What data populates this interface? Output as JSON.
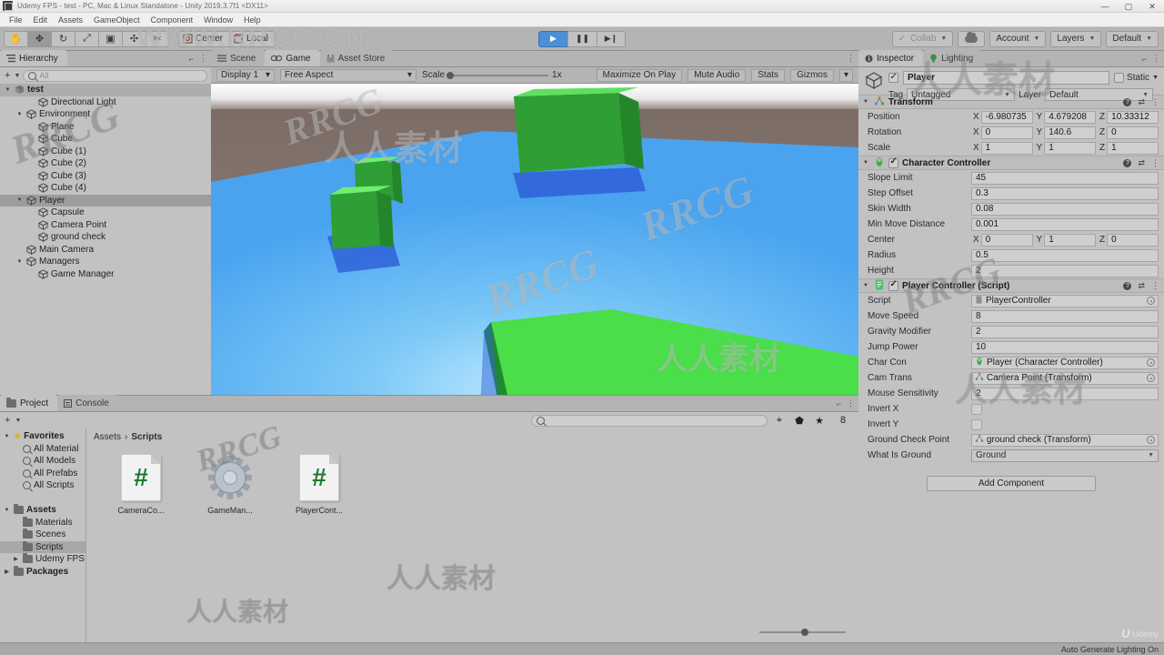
{
  "window": {
    "title": "Udemy FPS - test - PC, Mac & Linux Standalone - Unity 2019.3.7f1 <DX11>",
    "minimize": "—",
    "maximize": "▢",
    "close": "✕"
  },
  "menubar": {
    "items": [
      "File",
      "Edit",
      "Assets",
      "GameObject",
      "Component",
      "Window",
      "Help"
    ]
  },
  "toolbar": {
    "tools": [
      {
        "name": "hand-tool",
        "glyph": "✋",
        "active": false
      },
      {
        "name": "move-tool",
        "glyph": "✥",
        "active": true
      },
      {
        "name": "rotate-tool",
        "glyph": "↻",
        "active": false
      },
      {
        "name": "scale-tool",
        "glyph": "⤢",
        "active": false
      },
      {
        "name": "rect-tool",
        "glyph": "▣",
        "active": false
      },
      {
        "name": "transform-tool",
        "glyph": "✣",
        "active": false
      },
      {
        "name": "custom-tool",
        "glyph": "✂",
        "active": false
      }
    ],
    "pivot_mode": "Center",
    "pivot_space": "Local",
    "play_glyph": "▶",
    "pause_glyph": "❚❚",
    "step_glyph": "▶❙",
    "collab": "Collab",
    "account": "Account",
    "layers": "Layers",
    "layout": "Default"
  },
  "hierarchy": {
    "tab": "Hierarchy",
    "search_placeholder": "All",
    "create_label": "+",
    "items": [
      {
        "label": "test",
        "depth": 0,
        "twisty": "▼",
        "kind": "scene",
        "selected": false
      },
      {
        "label": "Directional Light",
        "depth": 2,
        "twisty": "",
        "kind": "object",
        "selected": false
      },
      {
        "label": "Environment",
        "depth": 1,
        "twisty": "▼",
        "kind": "object",
        "selected": false
      },
      {
        "label": "Plane",
        "depth": 2,
        "twisty": "",
        "kind": "object",
        "selected": false
      },
      {
        "label": "Cube",
        "depth": 2,
        "twisty": "",
        "kind": "object",
        "selected": false
      },
      {
        "label": "Cube (1)",
        "depth": 2,
        "twisty": "",
        "kind": "object",
        "selected": false
      },
      {
        "label": "Cube (2)",
        "depth": 2,
        "twisty": "",
        "kind": "object",
        "selected": false
      },
      {
        "label": "Cube (3)",
        "depth": 2,
        "twisty": "",
        "kind": "object",
        "selected": false
      },
      {
        "label": "Cube (4)",
        "depth": 2,
        "twisty": "",
        "kind": "object",
        "selected": false
      },
      {
        "label": "Player",
        "depth": 1,
        "twisty": "▼",
        "kind": "object",
        "selected": true
      },
      {
        "label": "Capsule",
        "depth": 2,
        "twisty": "",
        "kind": "object",
        "selected": false
      },
      {
        "label": "Camera Point",
        "depth": 2,
        "twisty": "",
        "kind": "object",
        "selected": false
      },
      {
        "label": "ground check",
        "depth": 2,
        "twisty": "",
        "kind": "object",
        "selected": false
      },
      {
        "label": "Main Camera",
        "depth": 1,
        "twisty": "",
        "kind": "object",
        "selected": false
      },
      {
        "label": "Managers",
        "depth": 1,
        "twisty": "▼",
        "kind": "object",
        "selected": false
      },
      {
        "label": "Game Manager",
        "depth": 2,
        "twisty": "",
        "kind": "object",
        "selected": false
      }
    ]
  },
  "sceneview": {
    "tabs": [
      {
        "label": "Scene",
        "selected": false
      },
      {
        "label": "Game",
        "selected": true
      },
      {
        "label": "Asset Store",
        "selected": false
      }
    ],
    "display": "Display 1",
    "aspect": "Free Aspect",
    "scale_label": "Scale",
    "scale_value": "1x",
    "maximize_on_play": "Maximize On Play",
    "mute_audio": "Mute Audio",
    "stats": "Stats",
    "gizmos": "Gizmos",
    "colors": {
      "sky_top": "#ffffff",
      "sky_band": "#7d6e68",
      "ground_light": "#7fc8f8",
      "ground_mid": "#4da6f0",
      "cube_front": "#2f9e34",
      "cube_top": "#5ee05e",
      "cube_side": "#23872a",
      "shadow": "#2f62d8"
    }
  },
  "inspector": {
    "tabs": [
      {
        "label": "Inspector",
        "selected": true
      },
      {
        "label": "Lighting",
        "selected": false
      }
    ],
    "object_name": "Player",
    "enabled": true,
    "static_label": "Static",
    "tag_label": "Tag",
    "tag_value": "Untagged",
    "layer_label": "Layer",
    "layer_value": "Default",
    "add_component": "Add Component",
    "components": [
      {
        "name": "Transform",
        "icon": "transform-icon",
        "has_enable_checkbox": false,
        "rows": [
          {
            "label": "Position",
            "type": "vector3",
            "x": "-6.980735",
            "y": "4.679208",
            "z": "10.33312"
          },
          {
            "label": "Rotation",
            "type": "vector3",
            "x": "0",
            "y": "140.6",
            "z": "0"
          },
          {
            "label": "Scale",
            "type": "vector3",
            "x": "1",
            "y": "1",
            "z": "1"
          }
        ]
      },
      {
        "name": "Character Controller",
        "icon": "character-controller-icon",
        "has_enable_checkbox": true,
        "enabled": true,
        "rows": [
          {
            "label": "Slope Limit",
            "type": "text",
            "value": "45"
          },
          {
            "label": "Step Offset",
            "type": "text",
            "value": "0.3"
          },
          {
            "label": "Skin Width",
            "type": "text",
            "value": "0.08"
          },
          {
            "label": "Min Move Distance",
            "type": "text",
            "value": "0.001"
          },
          {
            "label": "Center",
            "type": "vector3",
            "x": "0",
            "y": "1",
            "z": "0"
          },
          {
            "label": "Radius",
            "type": "text",
            "value": "0.5"
          },
          {
            "label": "Height",
            "type": "text",
            "value": "2"
          }
        ]
      },
      {
        "name": "Player Controller (Script)",
        "icon": "script-icon",
        "has_enable_checkbox": true,
        "enabled": true,
        "rows": [
          {
            "label": "Script",
            "type": "object",
            "value": "PlayerController",
            "dim": true,
            "icon": "script-glyph"
          },
          {
            "label": "Move Speed",
            "type": "text",
            "value": "8"
          },
          {
            "label": "Gravity Modifier",
            "type": "text",
            "value": "2"
          },
          {
            "label": "Jump Power",
            "type": "text",
            "value": "10"
          },
          {
            "label": "Char Con",
            "type": "object",
            "value": "Player (Character Controller)",
            "icon": "cc-glyph"
          },
          {
            "label": "Cam Trans",
            "type": "object",
            "value": "Camera Point (Transform)",
            "icon": "transform-glyph"
          },
          {
            "label": "Mouse Sensitivity",
            "type": "text",
            "value": "2"
          },
          {
            "label": "Invert X",
            "type": "checkbox",
            "checked": false
          },
          {
            "label": "Invert Y",
            "type": "checkbox",
            "checked": false
          },
          {
            "label": "Ground Check Point",
            "type": "object",
            "value": "ground check (Transform)",
            "icon": "transform-glyph"
          },
          {
            "label": "What Is Ground",
            "type": "dropdown",
            "value": "Ground"
          }
        ]
      }
    ]
  },
  "project": {
    "tabs": [
      {
        "label": "Project",
        "selected": true
      },
      {
        "label": "Console",
        "selected": false
      }
    ],
    "search_placeholder": "",
    "badge_count": "8",
    "tree": [
      {
        "label": "Favorites",
        "depth": 0,
        "twisty": "▼",
        "icon": "star",
        "bold": true,
        "selected": false
      },
      {
        "label": "All Material",
        "depth": 1,
        "twisty": "",
        "icon": "search",
        "bold": false,
        "selected": false
      },
      {
        "label": "All Models",
        "depth": 1,
        "twisty": "",
        "icon": "search",
        "bold": false,
        "selected": false
      },
      {
        "label": "All Prefabs",
        "depth": 1,
        "twisty": "",
        "icon": "search",
        "bold": false,
        "selected": false
      },
      {
        "label": "All Scripts",
        "depth": 1,
        "twisty": "",
        "icon": "search",
        "bold": false,
        "selected": false
      },
      {
        "label": "",
        "depth": 0,
        "twisty": "",
        "icon": "none",
        "bold": false,
        "selected": false
      },
      {
        "label": "Assets",
        "depth": 0,
        "twisty": "▼",
        "icon": "folderopen",
        "bold": true,
        "selected": false
      },
      {
        "label": "Materials",
        "depth": 1,
        "twisty": "",
        "icon": "folder",
        "bold": false,
        "selected": false
      },
      {
        "label": "Scenes",
        "depth": 1,
        "twisty": "",
        "icon": "folder",
        "bold": false,
        "selected": false
      },
      {
        "label": "Scripts",
        "depth": 1,
        "twisty": "",
        "icon": "folder",
        "bold": false,
        "selected": true
      },
      {
        "label": "Udemy FPS",
        "depth": 1,
        "twisty": "▶",
        "icon": "folder",
        "bold": false,
        "selected": false
      },
      {
        "label": "Packages",
        "depth": 0,
        "twisty": "▶",
        "icon": "folder",
        "bold": true,
        "selected": false
      }
    ],
    "breadcrumb": [
      "Assets",
      "Scripts"
    ],
    "assets": [
      {
        "label": "CameraCo...",
        "type": "csharp"
      },
      {
        "label": "GameMan...",
        "type": "gear"
      },
      {
        "label": "PlayerCont...",
        "type": "csharp"
      }
    ]
  },
  "statusbar": {
    "message": "Auto Generate Lighting On",
    "udemy": "Udemy"
  },
  "watermarks": {
    "url": "WWW.RRCG.CN",
    "rrcg": "RRCG",
    "cn": "人人素材"
  }
}
